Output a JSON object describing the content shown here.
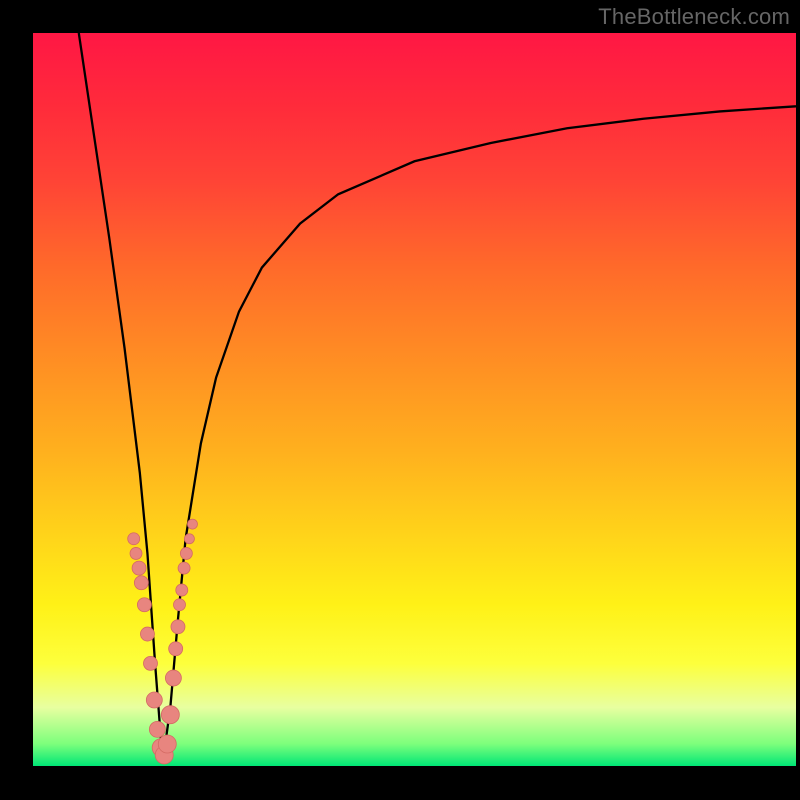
{
  "watermark": "TheBottleneck.com",
  "colors": {
    "frame": "#000000",
    "curve": "#000000",
    "marker_fill": "#e8857f",
    "marker_stroke": "#d46a63"
  },
  "chart_data": {
    "type": "line",
    "title": "",
    "xlabel": "",
    "ylabel": "",
    "xlim": [
      0,
      100
    ],
    "ylim": [
      0,
      100
    ],
    "grid": false,
    "legend": false,
    "annotations": [],
    "curve_description": "Bottleneck curve: steep descent from ~(6,100) to a minimum near x≈17 at y≈0, then asymptotic rise toward y≈90 as x→100.",
    "series": [
      {
        "name": "bottleneck-curve",
        "x": [
          6.0,
          8.0,
          10.0,
          12.0,
          14.0,
          15.0,
          16.0,
          17.0,
          18.0,
          19.0,
          20.0,
          22.0,
          24.0,
          27.0,
          30.0,
          35.0,
          40.0,
          50.0,
          60.0,
          70.0,
          80.0,
          90.0,
          100.0
        ],
        "y": [
          100.0,
          86.0,
          72.0,
          57.0,
          40.0,
          29.0,
          14.0,
          0.5,
          8.0,
          20.0,
          31.0,
          44.0,
          53.0,
          62.0,
          68.0,
          74.0,
          78.0,
          82.5,
          85.0,
          87.0,
          88.3,
          89.3,
          90.0
        ]
      }
    ],
    "markers": {
      "name": "highlighted-points",
      "x": [
        13.2,
        13.5,
        13.9,
        14.2,
        14.6,
        15.0,
        15.4,
        15.9,
        16.3,
        16.8,
        17.2,
        17.6,
        18.0,
        18.4,
        18.7,
        19.0,
        19.2,
        19.5,
        19.8,
        20.1,
        20.5,
        20.9
      ],
      "y": [
        31.0,
        29.0,
        27.0,
        25.0,
        22.0,
        18.0,
        14.0,
        9.0,
        5.0,
        2.5,
        1.5,
        3.0,
        7.0,
        12.0,
        16.0,
        19.0,
        22.0,
        24.0,
        27.0,
        29.0,
        31.0,
        33.0
      ],
      "r": [
        6,
        6,
        7,
        7,
        7,
        7,
        7,
        8,
        8,
        9,
        9,
        9,
        9,
        8,
        7,
        7,
        6,
        6,
        6,
        6,
        5,
        5
      ]
    }
  }
}
